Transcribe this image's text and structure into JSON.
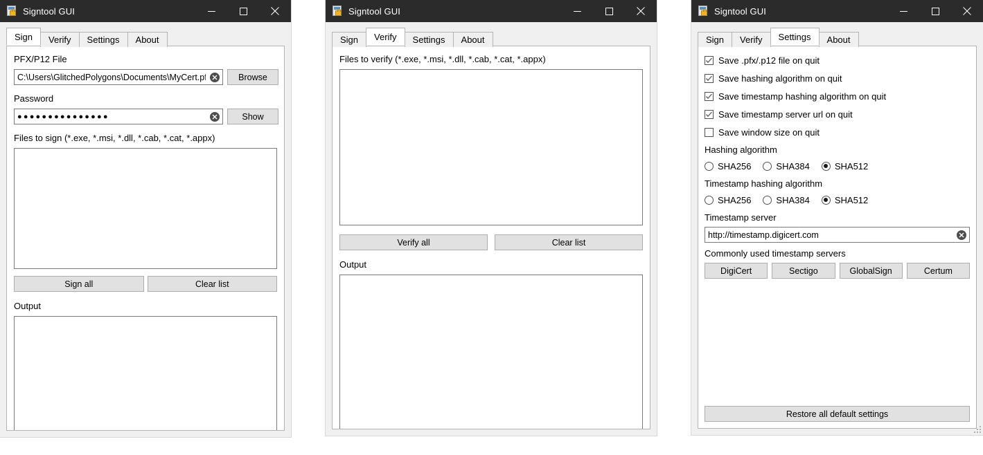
{
  "app": {
    "title": "Signtool GUI",
    "icon": "certificate-lock-icon"
  },
  "window_controls": {
    "minimize": "minimize-icon",
    "maximize": "maximize-icon",
    "close": "close-icon"
  },
  "tabs": [
    "Sign",
    "Verify",
    "Settings",
    "About"
  ],
  "windows": [
    {
      "active_tab": "Sign"
    },
    {
      "active_tab": "Verify"
    },
    {
      "active_tab": "Settings"
    }
  ],
  "sign_tab": {
    "pfx_label": "PFX/P12 File",
    "pfx_value": "C:\\Users\\GlitchedPolygons\\Documents\\MyCert.pfx",
    "browse_label": "Browse",
    "password_label": "Password",
    "password_value": "●●●●●●●●●●●●●●●",
    "show_label": "Show",
    "files_label": "Files to sign (*.exe, *.msi, *.dll, *.cab, *.cat, *.appx)",
    "files_value": "",
    "sign_all_label": "Sign all",
    "clear_list_label": "Clear list",
    "output_label": "Output",
    "output_value": ""
  },
  "verify_tab": {
    "files_label": "Files to verify (*.exe, *.msi, *.dll, *.cab, *.cat, *.appx)",
    "files_value": "",
    "verify_all_label": "Verify all",
    "clear_list_label": "Clear list",
    "output_label": "Output",
    "output_value": ""
  },
  "settings_tab": {
    "checkboxes": [
      {
        "label": "Save .pfx/.p12 file on quit",
        "checked": true
      },
      {
        "label": "Save hashing algorithm on quit",
        "checked": true
      },
      {
        "label": "Save timestamp hashing algorithm on quit",
        "checked": true
      },
      {
        "label": "Save timestamp server url on quit",
        "checked": true
      },
      {
        "label": "Save window size on quit",
        "checked": false
      }
    ],
    "hashing_label": "Hashing algorithm",
    "hashing_options": [
      "SHA256",
      "SHA384",
      "SHA512"
    ],
    "hashing_selected": "SHA512",
    "ts_hashing_label": "Timestamp hashing algorithm",
    "ts_hashing_options": [
      "SHA256",
      "SHA384",
      "SHA512"
    ],
    "ts_hashing_selected": "SHA512",
    "ts_server_label": "Timestamp server",
    "ts_server_value": "http://timestamp.digicert.com",
    "common_label": "Commonly used timestamp servers",
    "common_servers": [
      "DigiCert",
      "Sectigo",
      "GlobalSign",
      "Certum"
    ],
    "restore_label": "Restore all default settings"
  },
  "colors": {
    "titlebar": "#2b2b2b",
    "window_bg": "#f0f0f0",
    "panel_bg": "#ffffff",
    "border": "#b4b4b4",
    "field_border": "#7a7a7a",
    "button_bg": "#e1e1e1",
    "button_border": "#adadad",
    "text": "#000000",
    "title_text": "#ffffff"
  }
}
